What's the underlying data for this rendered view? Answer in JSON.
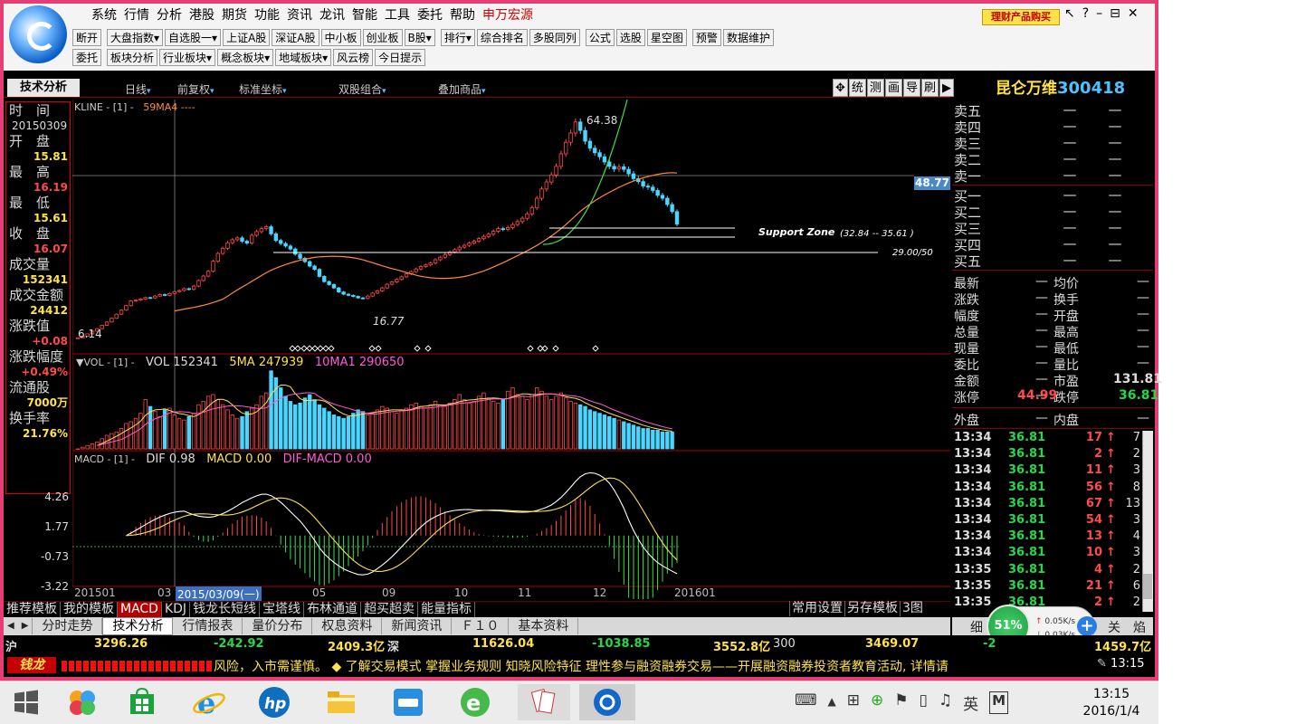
{
  "menu": [
    "系统",
    "行情",
    "分析",
    "港股",
    "期货",
    "功能",
    "资讯",
    "龙讯",
    "智能",
    "工具",
    "委托",
    "帮助",
    "申万宏源"
  ],
  "promo": "理财产品购买",
  "window_controls": [
    "↖",
    "?",
    "–",
    "⊟",
    "✕"
  ],
  "toolbar_row1": [
    "断开",
    "大盘指数▾",
    "自选股一▾",
    "上证A股",
    "深证A股",
    "中小板",
    "创业板",
    "B股▾",
    "排行▾",
    "综合排名",
    "多股同列",
    "公式",
    "选股",
    "星空图",
    "预警",
    "数据维护"
  ],
  "toolbar_row2": [
    "委托",
    "板块分析",
    "行业板块▾",
    "概念板块▾",
    "地域板块▾",
    "风云榜",
    "今日提示"
  ],
  "top_tab": "技术分析",
  "top_options": [
    {
      "label": "日线",
      "arrow": "▾"
    },
    {
      "label": "前复权",
      "arrow": "▾"
    },
    {
      "label": "标准坐标",
      "arrow": "▾"
    },
    {
      "label": "双股组合",
      "arrow": "▾"
    },
    {
      "label": "叠加商品",
      "arrow": "▾"
    }
  ],
  "right_tools": [
    "✥",
    "统",
    "测",
    "画",
    "导",
    "刷",
    "▶"
  ],
  "stock": {
    "name": "昆仑万维",
    "code": "300418"
  },
  "info": {
    "time_label": "时　间",
    "date": "20150309",
    "open_label": "开　盘",
    "open": "15.81",
    "high_label": "最　高",
    "high": "16.19",
    "low_label": "最　低",
    "low": "15.61",
    "close_label": "收　盘",
    "close": "16.07",
    "volume_label": "成交量",
    "volume": "152341",
    "amount_label": "成交金额",
    "amount": "24412",
    "change_label": "涨跌值",
    "change": "+0.08",
    "pct_label": "涨跌幅度",
    "pct": "+0.49%",
    "float_label": "流通股",
    "float": "7000万",
    "turnover_label": "换手率",
    "turnover": "21.76%"
  },
  "chart": {
    "kline_legend": "KLINE - [1] -",
    "ma_legend": "59MA4 ----",
    "price_tag": "48.77",
    "peak": "64.38",
    "low": "16.77",
    "start": "6.14",
    "support_label": "Support Zone",
    "support_range": "(32.84 -- 35.61 )",
    "level_label": "29.00/50",
    "vol_legend_prefix": "▼VOL - [1] -",
    "vol_value": "VOL 152341",
    "vol_ma5": "5MA 247939",
    "vol_ma10": "10MA1 290650",
    "macd_legend_prefix": "MACD - [1] -",
    "macd_dif": "DIF 0.98",
    "macd_macd": "MACD 0.00",
    "macd_diff": "DIF-MACD 0.00",
    "macd_y": [
      "4.26",
      "1.77",
      "-0.73",
      "-3.22"
    ],
    "x_labels": [
      "201501",
      "03",
      "05",
      "09",
      "10",
      "11",
      "12",
      "201601"
    ],
    "cursor_date": "2015/03/09(一)"
  },
  "chart_data": {
    "type": "candlestick",
    "title": "",
    "ylabel": "",
    "price_series": [
      6.14,
      6.6,
      7.2,
      7.9,
      8.6,
      9.5,
      10.4,
      11.4,
      12.5,
      13.6,
      14.8,
      16.07,
      16.3,
      16.6,
      17.0,
      16.9,
      17.4,
      17.8,
      17.6,
      18.1,
      18.6,
      18.9,
      19.4,
      19.2,
      20.1,
      21.6,
      22.8,
      24.1,
      26.8,
      28.9,
      30.3,
      31.8,
      32.6,
      33.1,
      32.2,
      31.7,
      33.8,
      34.8,
      35.6,
      36.1,
      34.2,
      32.4,
      31.6,
      30.9,
      30.1,
      28.7,
      27.6,
      26.7,
      25.5,
      24.6,
      22.7,
      21.3,
      20.5,
      19.6,
      18.5,
      17.9,
      17.6,
      17.3,
      16.9,
      16.77,
      17.4,
      18.2,
      18.8,
      19.6,
      20.6,
      21.2,
      21.9,
      22.6,
      23.4,
      24.0,
      24.7,
      25.4,
      25.8,
      26.3,
      27.2,
      27.9,
      28.6,
      29.3,
      29.9,
      30.6,
      31.1,
      31.7,
      32.2,
      32.9,
      33.5,
      34.1,
      34.9,
      35.6,
      35.4,
      35.9,
      36.7,
      37.5,
      38.4,
      39.6,
      41.2,
      43.8,
      46.3,
      48.2,
      50.1,
      52.4,
      55.8,
      58.9,
      61.4,
      64.38,
      62.1,
      59.2,
      57.3,
      56.1,
      55.0,
      53.6,
      52.4,
      51.7,
      52.3,
      51.6,
      50.4,
      49.1,
      48.3,
      47.1,
      46.8,
      45.9,
      44.6,
      43.8,
      42.1,
      40.2,
      36.81
    ],
    "volume": [
      0.0,
      0.1,
      0.2,
      0.3,
      0.4,
      0.6,
      0.8,
      0.9,
      1.0,
      1.2,
      1.5,
      1.6,
      1.8,
      2.1,
      2.9,
      2.5,
      2.2,
      1.9,
      2.3,
      2.4,
      2.0,
      1.8,
      1.7,
      1.9,
      2.1,
      2.6,
      2.8,
      3.1,
      3.2,
      2.9,
      2.6,
      2.3,
      2.0,
      1.8,
      1.9,
      2.2,
      2.4,
      2.6,
      3.1,
      3.3,
      4.6,
      4.2,
      3.6,
      3.1,
      2.8,
      2.6,
      2.7,
      3.0,
      3.2,
      2.9,
      2.6,
      2.4,
      2.2,
      2.0,
      1.9,
      1.8,
      1.9,
      2.1,
      2.3,
      2.2,
      2.0,
      2.1,
      2.3,
      2.5,
      2.4,
      2.2,
      2.1,
      2.3,
      2.4,
      2.6,
      2.7,
      2.5,
      2.4,
      2.6,
      2.8,
      2.6,
      2.5,
      2.7,
      2.9,
      3.2,
      2.9,
      2.7,
      2.8,
      3.1,
      3.3,
      3.0,
      2.8,
      2.7,
      2.9,
      3.4,
      3.6,
      3.2,
      3.1,
      2.9,
      3.2,
      3.6,
      3.4,
      3.1,
      2.9,
      3.1,
      3.3,
      3.0,
      2.8,
      2.7,
      2.6,
      2.5,
      2.3,
      2.2,
      2.1,
      2.0,
      1.9,
      1.8,
      1.7,
      1.6,
      1.5,
      1.4,
      1.3,
      1.2,
      1.2,
      1.1,
      1.1,
      1.0,
      1.0,
      1.0
    ],
    "macd_range": [
      -3.22,
      4.26
    ]
  },
  "formula_tabs": [
    "推荐模板",
    "我的模板",
    "MACD",
    "KDJ",
    "钱龙长短线",
    "宝塔线",
    "布林通道",
    "超买超卖",
    "能量指标"
  ],
  "formula_right": [
    "常用设置",
    "另存模板",
    "3图"
  ],
  "view_tabs": [
    "分时走势",
    "技术分析",
    "行情报表",
    "量价分布",
    "权息资料",
    "新闻资讯",
    "Ｆ１０",
    "基本资料"
  ],
  "quote": {
    "sell": [
      "卖五",
      "卖四",
      "卖三",
      "卖二",
      "卖一"
    ],
    "buy": [
      "买一",
      "买二",
      "买三",
      "买四",
      "买五"
    ],
    "dash": "—",
    "stats_left": [
      "最新",
      "涨跌",
      "幅度",
      "总量",
      "现量",
      "委比",
      "金额",
      "涨停"
    ],
    "stats_right": [
      "均价",
      "换手",
      "开盘",
      "最高",
      "最低",
      "量比",
      "市盈",
      "跌停"
    ],
    "amount_val": "131.81",
    "limit_up": "44.99",
    "limit_down": "36.81",
    "outer": "外盘",
    "inner": "内盘"
  },
  "ticks": [
    {
      "t": "13:34",
      "p": "36.81",
      "v": "17",
      "n": "7"
    },
    {
      "t": "13:34",
      "p": "36.81",
      "v": "2",
      "n": "2"
    },
    {
      "t": "13:34",
      "p": "36.81",
      "v": "11",
      "n": "3"
    },
    {
      "t": "13:34",
      "p": "36.81",
      "v": "56",
      "n": "8"
    },
    {
      "t": "13:34",
      "p": "36.81",
      "v": "67",
      "n": "13"
    },
    {
      "t": "13:34",
      "p": "36.81",
      "v": "54",
      "n": "3"
    },
    {
      "t": "13:34",
      "p": "36.81",
      "v": "13",
      "n": "4"
    },
    {
      "t": "13:34",
      "p": "36.81",
      "v": "10",
      "n": "3"
    },
    {
      "t": "13:35",
      "p": "36.81",
      "v": "4",
      "n": "2"
    },
    {
      "t": "13:35",
      "p": "36.81",
      "v": "21",
      "n": "6"
    },
    {
      "t": "13:35",
      "p": "36.81",
      "v": "2",
      "n": "2"
    }
  ],
  "detail_tabs": "细",
  "detail_tabs_right": [
    "关",
    "焰"
  ],
  "net": {
    "pct": "51%",
    "up": "0.05K/s",
    "down": "0.03K/s"
  },
  "index_bar": {
    "sh_label": "沪",
    "sh": "3296.26",
    "sh_chg": "-242.92",
    "sh_amt": "2409.3亿",
    "sz_label": "深",
    "sz": "11626.04",
    "sz_chg": "-1038.85",
    "sz_amt": "3552.8亿",
    "c300_label": "300",
    "c300": "3469.07",
    "c300_chg": "-2",
    "c300_amt": "1459.7亿"
  },
  "ticker": {
    "logo": "钱龙",
    "text": "风险，入市需谨慎。 ◆ 了解交易模式 掌握业务规则 知晓风险特征 理性参与融资融券交易——开展融资融券投资者教育活动, 详情请",
    "time": "13:15"
  },
  "taskbar": {
    "time": "13:15",
    "date": "2016/1/4",
    "ime": "英",
    "ime2": "M"
  }
}
